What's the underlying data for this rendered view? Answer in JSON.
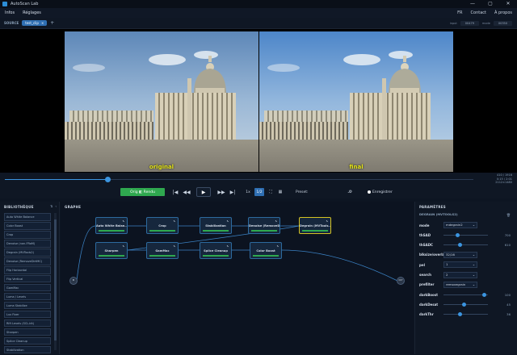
{
  "app": {
    "title": "AutoScan Lab"
  },
  "window_controls": {
    "minimize": "—",
    "maximize": "▢",
    "close": "✕"
  },
  "menu": {
    "info": "Infos",
    "settings": "Réglages",
    "lang": "FR",
    "contact": "Contact",
    "about": "À propos"
  },
  "source": {
    "label": "SOURCE",
    "chip": "test_clip",
    "chip_close": "×",
    "add": "+",
    "info_labels": [
      "input",
      "mode"
    ],
    "info_values": [
      "00479",
      "00350"
    ]
  },
  "viewer": {
    "left_label": "original",
    "right_label": "final"
  },
  "timeline": {
    "progress": 0.22,
    "frame": "410 / 1916",
    "time": "0:15 / 2:01",
    "resolution": "2112×1480"
  },
  "controls": {
    "compare_button": "Orig ◧ Rendu",
    "skip_start": "|◀",
    "prev": "◀◀",
    "play": "▶",
    "next": "▶▶",
    "skip_end": "▶|",
    "speed_1": "1x",
    "speed_half": "1/2",
    "preset_label": "Preset:",
    "preset_value": "",
    "save_label": "Enregistrer"
  },
  "library": {
    "title": "BIBLIOTHÈQUE",
    "items": [
      "Auto White Balance",
      "Color Boost",
      "Crop",
      "Denoise (non-FRoM)",
      "Degrain (MVTools2)",
      "Denoise (RemoveDirtMC)",
      "Flip Horizontal",
      "Flip Vertical",
      "GamMac",
      "Luma / Levels",
      "Luma Stabilize",
      "Lux Fixer",
      "Rift Levels (SCL-kit)",
      "Sharpen",
      "Splice Cleanup",
      "Stabilization"
    ]
  },
  "graph": {
    "title": "GRAPHE",
    "nodes_row1": [
      "Auto White Balan…",
      "Crop",
      "Stabilization",
      "Denoise (RemoveD…",
      "Degrain (MVTools…"
    ],
    "nodes_row2": [
      "Sharpen",
      "GamMac",
      "Splice Cleanup",
      "Color Boost"
    ],
    "input_label": "IN",
    "output_label": "OUT"
  },
  "params": {
    "title": "PARAMÈTRES",
    "subtitle": "DEGRAIN (MVTOOLS2)",
    "rows": [
      {
        "label": "mode",
        "value": "mdegrain2",
        "kind": "select"
      },
      {
        "label": "thSAD",
        "value": "700",
        "kind": "slider",
        "level": 0.3
      },
      {
        "label": "thSADC",
        "value": "610",
        "kind": "slider",
        "level": 0.35
      },
      {
        "label": "blksize/overlap",
        "value": "32/16",
        "kind": "select"
      },
      {
        "label": "pel",
        "value": "1",
        "kind": "select"
      },
      {
        "label": "search",
        "value": "2",
        "kind": "select"
      },
      {
        "label": "prefilter",
        "value": "removegrain",
        "kind": "select"
      },
      {
        "label": "darkBoost",
        "value": "100",
        "kind": "slider",
        "level": 0.95
      },
      {
        "label": "darkDesat",
        "value": "45",
        "kind": "slider",
        "level": 0.45
      },
      {
        "label": "darkThr",
        "value": "36",
        "kind": "slider",
        "level": 0.35
      }
    ]
  },
  "colors": {
    "accent": "#3b95e0",
    "green": "#2fa84f",
    "selected": "#d6c322",
    "label_yellow": "#e4e41a"
  }
}
